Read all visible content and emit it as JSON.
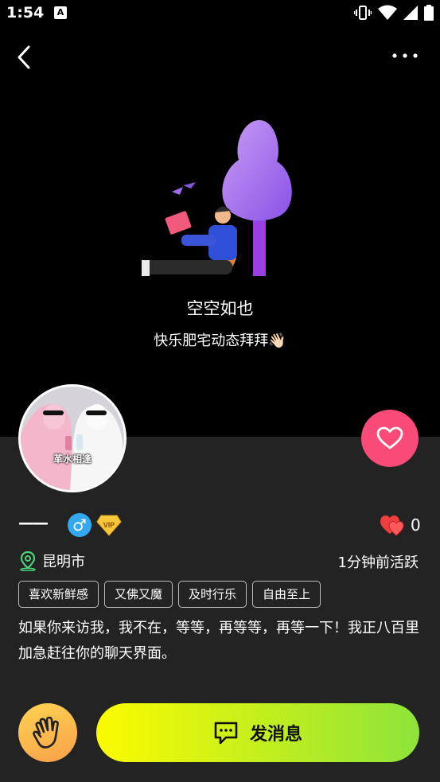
{
  "status_bar": {
    "time": "1:54",
    "a_badge": "A"
  },
  "empty_state": {
    "title": "空空如也",
    "subtitle": "快乐肥宅动态拜拜👋🏻"
  },
  "profile": {
    "avatar_caption": "革水相逢",
    "name": "——",
    "gender_symbol": "♂",
    "vip_label": "VIP",
    "likes_count": "0",
    "location": "昆明市",
    "active_status": "1分钟前活跃",
    "tags": [
      "喜欢新鲜感",
      "又佛又魔",
      "及时行乐",
      "自由至上"
    ],
    "bio": "如果你来访我，我不在，等等，再等等，再等一下！我正八百里加急赶往你的聊天界面。"
  },
  "actions": {
    "send_message_label": "发消息"
  },
  "colors": {
    "like_button": "#fa4b78",
    "gender_badge": "#31a8ef",
    "message_gradient_start": "#fbfb00",
    "message_gradient_end": "#8ee33a",
    "wave_gradient_start": "#ffd451",
    "wave_gradient_end": "#f9a04a",
    "panel_bg": "#232323"
  }
}
